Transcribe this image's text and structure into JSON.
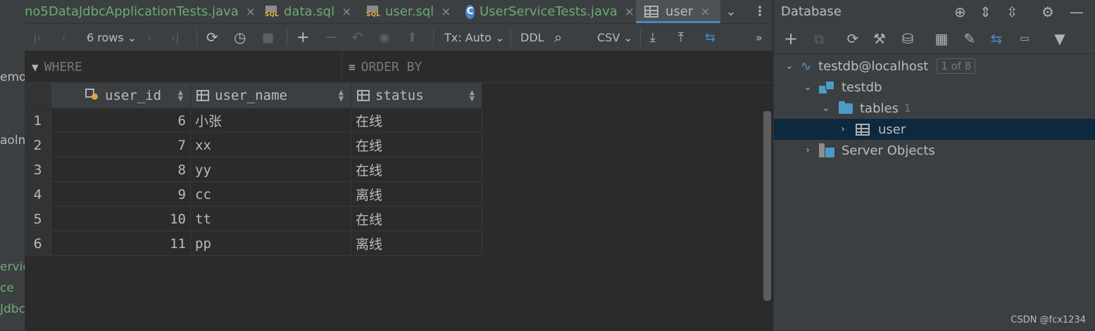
{
  "gutter": {
    "fragments": [
      "emo",
      "aoln",
      "ervic",
      "ce",
      "Jdbc"
    ]
  },
  "tabs": [
    {
      "label": "no5DataJdbcApplicationTests.java",
      "close": "×"
    },
    {
      "label": "data.sql",
      "close": "×",
      "icon_text": "SQL"
    },
    {
      "label": "user.sql",
      "close": "×",
      "icon_text": "SQL"
    },
    {
      "label": "UserServiceTests.java",
      "close": "×"
    },
    {
      "label": "user",
      "close": "×"
    }
  ],
  "toolbar": {
    "rows": "6 rows",
    "tx": "Tx: Auto",
    "ddl": "DDL",
    "csv": "CSV"
  },
  "filter": {
    "where": "WHERE",
    "order_by": "ORDER BY"
  },
  "grid": {
    "columns": [
      "user_id",
      "user_name",
      "status"
    ],
    "rows": [
      {
        "n": "1",
        "user_id": "6",
        "user_name": "小张",
        "status": "在线"
      },
      {
        "n": "2",
        "user_id": "7",
        "user_name": "xx",
        "status": "在线"
      },
      {
        "n": "3",
        "user_id": "8",
        "user_name": "yy",
        "status": "在线"
      },
      {
        "n": "4",
        "user_id": "9",
        "user_name": "cc",
        "status": "离线"
      },
      {
        "n": "5",
        "user_id": "10",
        "user_name": "tt",
        "status": "在线"
      },
      {
        "n": "6",
        "user_id": "11",
        "user_name": "pp",
        "status": "离线"
      }
    ]
  },
  "panel": {
    "title": "Database",
    "tree": {
      "datasource": "testdb@localhost",
      "datasource_badge": "1 of 8",
      "schema": "testdb",
      "tables_folder": "tables",
      "tables_count": "1",
      "table": "user",
      "server_objects": "Server Objects"
    }
  },
  "watermark": "CSDN @fcx1234",
  "colors": {
    "accent": "#4a88c7",
    "selection": "#0d293e",
    "key": "#d9a441"
  }
}
